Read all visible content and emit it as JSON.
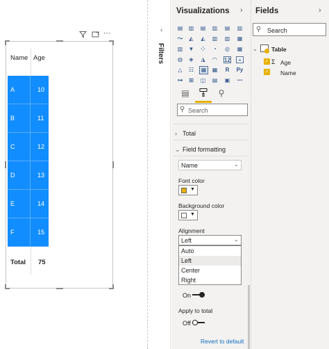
{
  "canvas": {
    "table": {
      "headers": [
        "Name",
        "Age"
      ],
      "rows": [
        {
          "name": "A",
          "age": "10"
        },
        {
          "name": "B",
          "age": "11"
        },
        {
          "name": "C",
          "age": "12"
        },
        {
          "name": "D",
          "age": "13"
        },
        {
          "name": "E",
          "age": "14"
        },
        {
          "name": "F",
          "age": "15"
        }
      ],
      "total_label": "Total",
      "total_value": "75",
      "cell_color": "#118dff"
    },
    "visual_header_icons": [
      "filter-icon",
      "focus-mode-icon",
      "more-options-icon"
    ]
  },
  "filters": {
    "label": "Filters"
  },
  "visualizations": {
    "title": "Visualizations",
    "search_placeholder": "Search",
    "sections": {
      "total": "Total",
      "field_formatting": "Field formatting"
    },
    "field_select": "Name",
    "font_color_label": "Font color",
    "font_color": "#e8b000",
    "background_color_label": "Background color",
    "background_color": "#ffffff",
    "alignment_label": "Alignment",
    "alignment_value": "Left",
    "alignment_options": [
      "Auto",
      "Left",
      "Center",
      "Right"
    ],
    "toggle_on_label": "On",
    "apply_to_total_label": "Apply to total",
    "toggle_off_label": "Off",
    "revert_label": "Revert to default"
  },
  "fields": {
    "title": "Fields",
    "search_placeholder": "Search",
    "table_name": "Table",
    "items": [
      {
        "name": "Age",
        "summed": true
      },
      {
        "name": "Name",
        "summed": false
      }
    ]
  }
}
